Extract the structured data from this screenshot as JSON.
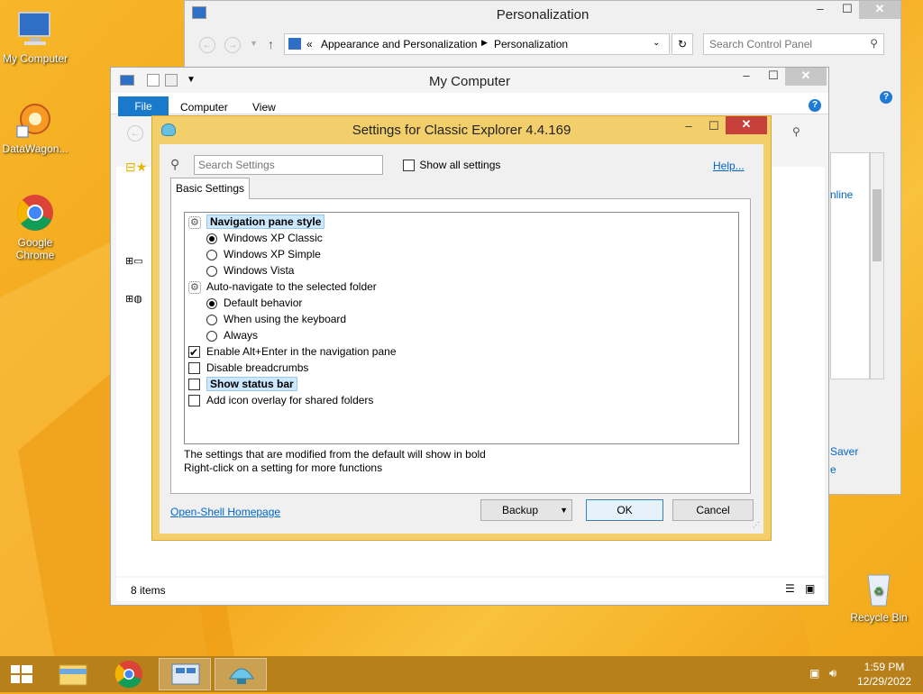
{
  "desktop": {
    "icons": [
      {
        "label": "My Computer"
      },
      {
        "label": "DataWagon..."
      },
      {
        "label": "Google Chrome"
      },
      {
        "label": "Recycle Bin"
      }
    ]
  },
  "personalization": {
    "title": "Personalization",
    "breadcrumb": [
      "«",
      "Appearance and Personalization",
      "Personalization"
    ],
    "search_placeholder": "Search Control Panel",
    "partial_texts": [
      "nline",
      "Saver",
      "e"
    ]
  },
  "mycomputer": {
    "title": "My Computer",
    "tabs": [
      "File",
      "Computer",
      "View"
    ],
    "status": "8 items"
  },
  "dialog": {
    "title": "Settings for Classic Explorer 4.4.169",
    "search_placeholder": "Search Settings",
    "show_all_label": "Show all settings",
    "show_all_checked": false,
    "help_label": "Help...",
    "tab_label": "Basic Settings",
    "settings": [
      {
        "type": "group",
        "label": "Navigation pane style",
        "bold": true,
        "highlight": true
      },
      {
        "type": "radio",
        "label": "Windows XP Classic",
        "checked": true
      },
      {
        "type": "radio",
        "label": "Windows XP Simple",
        "checked": false
      },
      {
        "type": "radio",
        "label": "Windows Vista",
        "checked": false
      },
      {
        "type": "group",
        "label": "Auto-navigate to the selected folder",
        "bold": false,
        "highlight": false
      },
      {
        "type": "radio",
        "label": "Default behavior",
        "checked": true
      },
      {
        "type": "radio",
        "label": "When using the keyboard",
        "checked": false
      },
      {
        "type": "radio",
        "label": "Always",
        "checked": false
      },
      {
        "type": "check",
        "label": "Enable Alt+Enter in the navigation pane",
        "checked": true
      },
      {
        "type": "check",
        "label": "Disable breadcrumbs",
        "checked": false
      },
      {
        "type": "check",
        "label": "Show status bar",
        "checked": false,
        "bold": true,
        "highlight": true
      },
      {
        "type": "check",
        "label": "Add icon overlay for shared folders",
        "checked": false
      }
    ],
    "info_line1": "The settings that are modified from the default will show in bold",
    "info_line2": "Right-click on a setting for more functions",
    "homepage_link": "Open-Shell Homepage",
    "backup_label": "Backup",
    "ok_label": "OK",
    "cancel_label": "Cancel"
  },
  "taskbar": {
    "time": "1:59 PM",
    "date": "12/29/2022"
  }
}
